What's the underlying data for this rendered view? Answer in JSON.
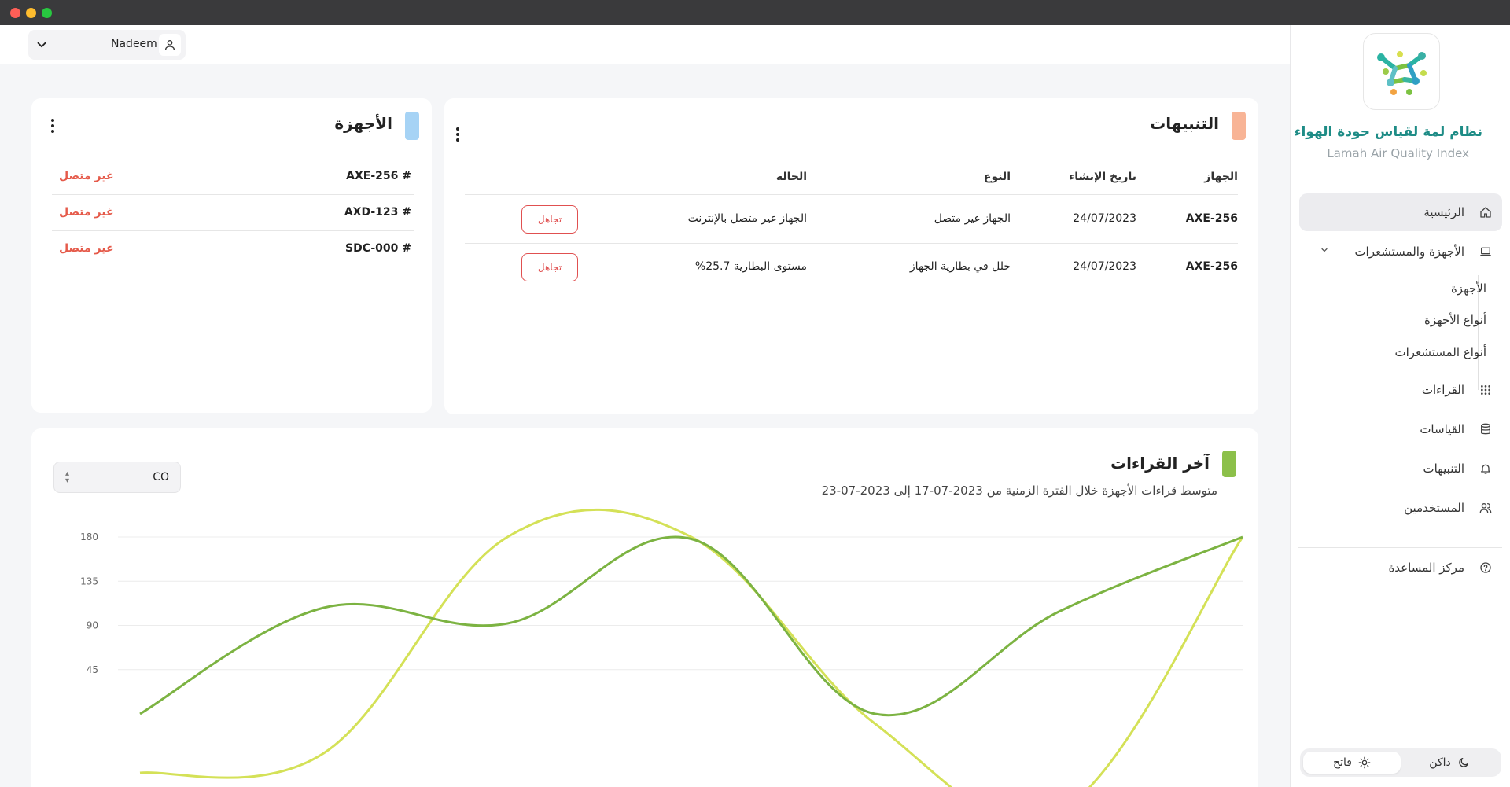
{
  "window": {},
  "header": {
    "user": {
      "name": "Nadeem"
    }
  },
  "sidebar": {
    "brand_ar": "نظام لمة لقياس جودة الهواء",
    "brand_en": "Lamah Air Quality Index",
    "items": [
      {
        "label": "الرئيسية",
        "icon": "home-icon",
        "active": true
      },
      {
        "label": "الأجهزة والمستشعرات",
        "icon": "laptop-icon",
        "expanded": true
      },
      {
        "label": "القراءات",
        "icon": "grid-dots-icon"
      },
      {
        "label": "القياسات",
        "icon": "database-icon"
      },
      {
        "label": "التنبيهات",
        "icon": "bell-icon"
      },
      {
        "label": "المستخدمين",
        "icon": "users-icon"
      }
    ],
    "sub_items": [
      "الأجهزة",
      "أنواع الأجهزة",
      "أنواع المستشعرات"
    ],
    "help": {
      "label": "مركز المساعدة",
      "icon": "help-circle-icon"
    },
    "theme": {
      "light": "فاتح",
      "dark": "داكن"
    }
  },
  "alerts": {
    "title": "التنبيهات",
    "accent": "#f8b496",
    "columns": {
      "device": "الجهاز",
      "created": "تاريخ الإنشاء",
      "type": "النوع",
      "status": "الحالة"
    },
    "rows": [
      {
        "device": "AXE-256",
        "created": "24/07/2023",
        "type": "الجهاز غير متصل",
        "status": "الجهاز غير متصل بالإنترنت",
        "action": "تجاهل"
      },
      {
        "device": "AXE-256",
        "created": "24/07/2023",
        "type": "خلل في بطارية الجهاز",
        "status": "مستوى البطارية 25.7%",
        "action": "تجاهل"
      }
    ]
  },
  "devices": {
    "title": "الأجهزة",
    "accent": "#a6d3f5",
    "items": [
      {
        "name": "AXE-256 #",
        "status": "غير متصل"
      },
      {
        "name": "AXD-123 #",
        "status": "غير متصل"
      },
      {
        "name": "SDC-000 #",
        "status": "غير متصل"
      }
    ]
  },
  "readings": {
    "title": "آخر القراءات",
    "accent": "#8cc04a",
    "subtitle": "متوسط قراءات الأجهزة خلال الفترة الزمنية من 2023-07-17 إلى 2023-07-23",
    "select": {
      "value": "CO"
    }
  },
  "chart_data": {
    "type": "line",
    "title": "آخر القراءات",
    "xlabel": "",
    "ylabel": "",
    "ylim": [
      0,
      180
    ],
    "yticks": [
      45,
      90,
      135,
      180
    ],
    "x": [
      0,
      1,
      2,
      3,
      4,
      5,
      6
    ],
    "legend": false,
    "grid": true,
    "series": [
      {
        "color": "#7cb342",
        "values": [
          0,
          108,
          92,
          178,
          0,
          104,
          180
        ]
      },
      {
        "color": "#d4e157",
        "values": [
          -60,
          -40,
          180,
          180,
          -10,
          -100,
          180
        ]
      }
    ]
  }
}
